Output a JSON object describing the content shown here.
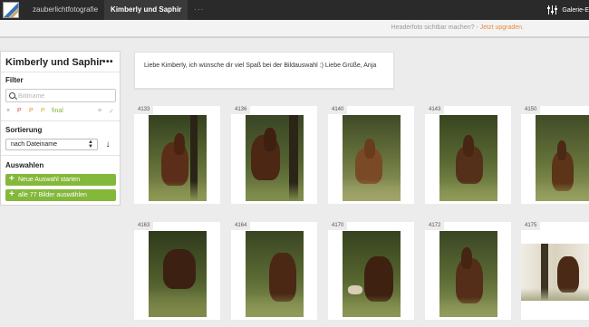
{
  "topbar": {
    "brand": "zauberlichtfotografie",
    "gallery": "Kimberly und Saphir",
    "more": "···",
    "right_label": "Galerie-E",
    "right_icon": "sliders-icon"
  },
  "header_notice": {
    "text": "Headerfoto sichtbar machen? -",
    "link": "Jetzt upgraden."
  },
  "sidebar": {
    "title": "Kimberly und Saphir",
    "menu": "•••",
    "filter_heading": "Filter",
    "search_placeholder": "Bildname",
    "filter_labels": [
      "×",
      "P",
      "P",
      "P",
      "final"
    ],
    "sort_heading": "Sortierung",
    "sort_value": "nach Dateiname",
    "sort_direction": "↓",
    "selection_heading": "Auswahlen",
    "new_selection": "Neue Auswahl starten",
    "select_all": "alle 77 Bilder auswählen",
    "colors": {
      "accent_green": "#84b83a",
      "filter_orange": "#e98a3c",
      "filter_red": "#d9534f"
    }
  },
  "message": {
    "text": "Liebe Kimberly, ich wünsche dir viel Spaß bei der Bildauswahl :) Liebe Grüße, Anja"
  },
  "photos": [
    {
      "number": "4133"
    },
    {
      "number": "4136"
    },
    {
      "number": "4140"
    },
    {
      "number": "4143"
    },
    {
      "number": "4150"
    },
    {
      "number": "4163"
    },
    {
      "number": "4164"
    },
    {
      "number": "4170"
    },
    {
      "number": "4172"
    },
    {
      "number": "4175"
    }
  ]
}
